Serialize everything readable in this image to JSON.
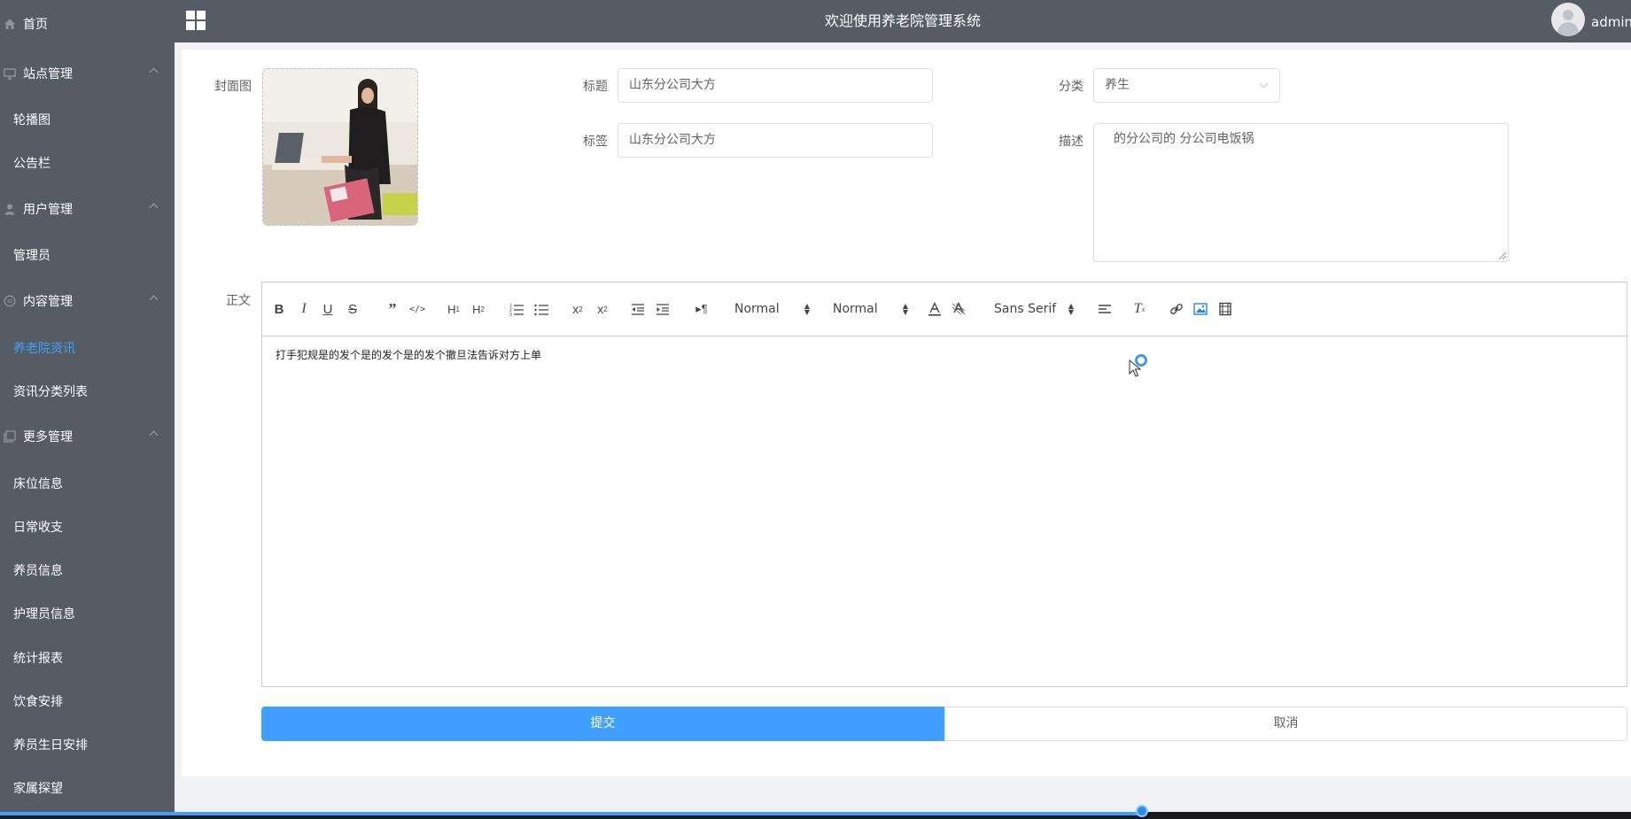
{
  "sidebar": {
    "items": [
      {
        "label": "首页",
        "type": "top",
        "icon": "home-icon"
      },
      {
        "label": "站点管理",
        "type": "top",
        "icon": "monitor-icon",
        "expanded": true
      },
      {
        "label": "轮播图",
        "type": "sub"
      },
      {
        "label": "公告栏",
        "type": "sub"
      },
      {
        "label": "用户管理",
        "type": "top",
        "icon": "user-icon",
        "expanded": true
      },
      {
        "label": "管理员",
        "type": "sub"
      },
      {
        "label": "内容管理",
        "type": "top",
        "icon": "circle-list-icon",
        "expanded": true
      },
      {
        "label": "养老院资讯",
        "type": "sub",
        "active": true
      },
      {
        "label": "资讯分类列表",
        "type": "sub"
      },
      {
        "label": "更多管理",
        "type": "top",
        "icon": "copy-icon",
        "expanded": true
      },
      {
        "label": "床位信息",
        "type": "sub"
      },
      {
        "label": "日常收支",
        "type": "sub"
      },
      {
        "label": "养员信息",
        "type": "sub"
      },
      {
        "label": "护理员信息",
        "type": "sub"
      },
      {
        "label": "统计报表",
        "type": "sub"
      },
      {
        "label": "饮食安排",
        "type": "sub"
      },
      {
        "label": "养员生日安排",
        "type": "sub"
      },
      {
        "label": "家属探望",
        "type": "sub"
      }
    ]
  },
  "header": {
    "title": "欢迎使用养老院管理系统",
    "username": "admin"
  },
  "form": {
    "cover_label": "封面图",
    "title_label": "标题",
    "title_value": "山东分公司大方",
    "tag_label": "标签",
    "tag_value": "山东分公司大方",
    "category_label": "分类",
    "category_value": "养生",
    "desc_label": "描述",
    "desc_value": "的分公司的 分公司电饭锅",
    "content_label": "正文",
    "content_value": "打手犯规是的发个是的发个是的发个撤旦法告诉对方上单"
  },
  "toolbar": {
    "header_select": "Normal",
    "size_select": "Normal",
    "font_select": "Sans Serif"
  },
  "buttons": {
    "submit": "提交",
    "cancel": "取消"
  },
  "colors": {
    "sidebar_bg": "#545c64",
    "accent": "#409eff"
  }
}
